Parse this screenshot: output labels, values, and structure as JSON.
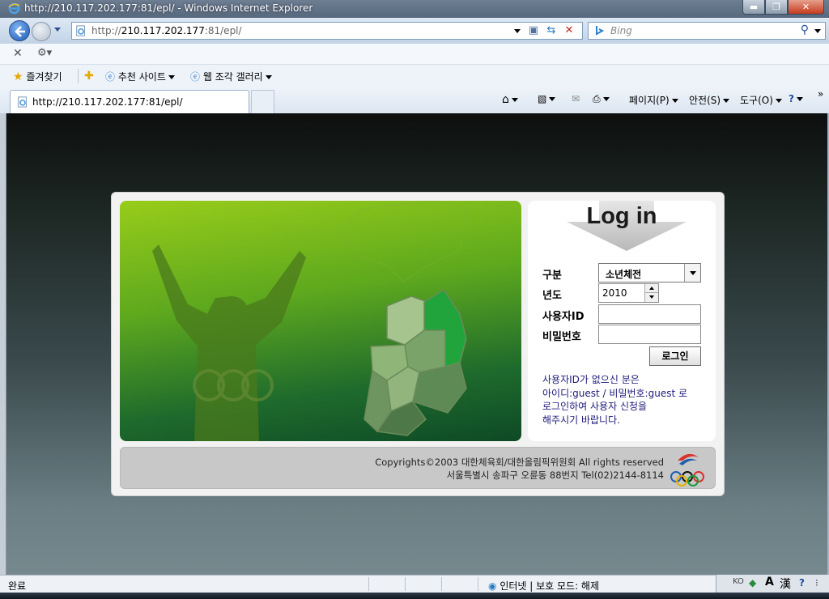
{
  "window": {
    "title": "http://210.117.202.177:81/epl/ - Windows Internet Explorer",
    "minimize": "▬",
    "maximize": "❐",
    "close": "✕"
  },
  "address": {
    "url_prefix": "http://",
    "url_host": "210.117.202.177",
    "url_rest": ":81/epl/"
  },
  "search": {
    "placeholder": "Bing"
  },
  "favorites": {
    "favorites_label": "즐겨찾기",
    "suggested_sites": "추천 사이트",
    "web_slice_gallery": "웹 조각 갤러리"
  },
  "tab": {
    "label": "http://210.117.202.177:81/epl/"
  },
  "command_bar": {
    "page": "페이지(P)",
    "safety": "안전(S)",
    "tools": "도구(O)",
    "more": "»"
  },
  "login": {
    "title": "Log in",
    "category_label": "구분",
    "category_value": "소년체전",
    "year_label": "년도",
    "year_value": "2010",
    "userid_label": "사용자ID",
    "password_label": "비밀번호",
    "login_button": "로그인",
    "notice_lines": [
      "사용자ID가 없으신 분은",
      "아이디:guest / 비밀번호:guest 로",
      "로그인하여 사용자 신청을",
      "해주시기 바랍니다."
    ]
  },
  "footer": {
    "copyright": "Copyrights©2003 대한체육회/대한올림픽위원회 All rights reserved",
    "address": "서울특별시 송파구 오륜동 88번지 Tel(02)2144-8114"
  },
  "status": {
    "done": "완료",
    "zone": "인터넷 | 보호 모드: 해제",
    "ime_lang": "KO",
    "ime_mode": "A",
    "ime_hanja": "漢"
  },
  "colors": {
    "accent_blue": "#1f4f9a",
    "hero_green": "#5da81e",
    "notice_text": "#1f1a7a"
  }
}
